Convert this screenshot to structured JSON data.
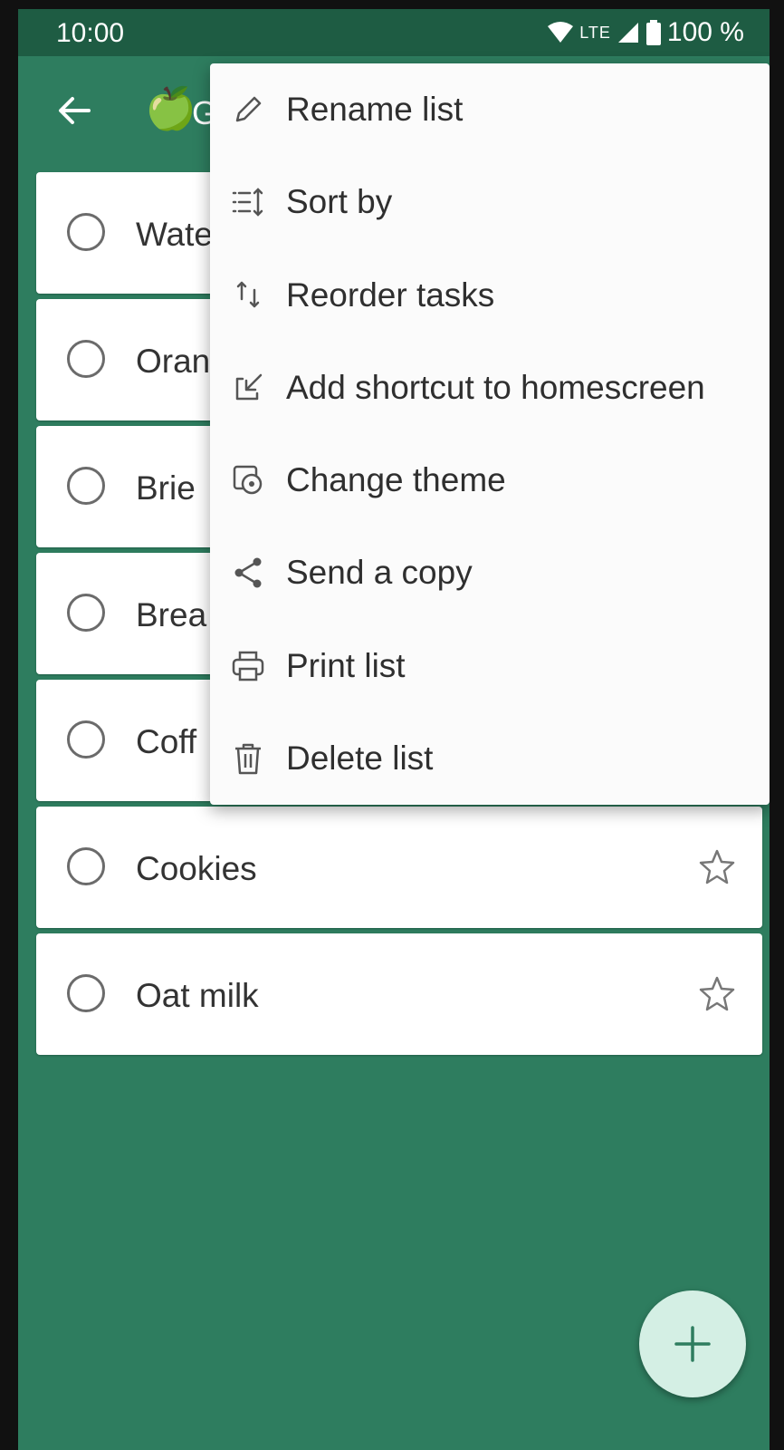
{
  "status_bar": {
    "time": "10:00",
    "network": "LTE",
    "battery": "100 %"
  },
  "app_bar": {
    "title": "G",
    "emoji": "🍏"
  },
  "tasks": [
    {
      "label": "Wate",
      "starred": false
    },
    {
      "label": "Oran",
      "starred": false
    },
    {
      "label": "Brie",
      "starred": false
    },
    {
      "label": "Brea",
      "starred": false
    },
    {
      "label": "Coff",
      "starred": false
    },
    {
      "label": "Cookies",
      "starred": false
    },
    {
      "label": "Oat milk",
      "starred": false
    }
  ],
  "menu": {
    "items": [
      {
        "label": "Rename list",
        "icon": "pencil-icon"
      },
      {
        "label": "Sort by",
        "icon": "sort-icon"
      },
      {
        "label": "Reorder tasks",
        "icon": "reorder-icon"
      },
      {
        "label": "Add shortcut to homescreen",
        "icon": "shortcut-icon"
      },
      {
        "label": "Change theme",
        "icon": "theme-icon"
      },
      {
        "label": "Send a copy",
        "icon": "share-icon"
      },
      {
        "label": "Print list",
        "icon": "printer-icon"
      },
      {
        "label": "Delete list",
        "icon": "trash-icon"
      }
    ]
  },
  "colors": {
    "theme_green": "#2e7d5f",
    "status_bar": "#1e5c43",
    "fab": "#d4efe4"
  }
}
